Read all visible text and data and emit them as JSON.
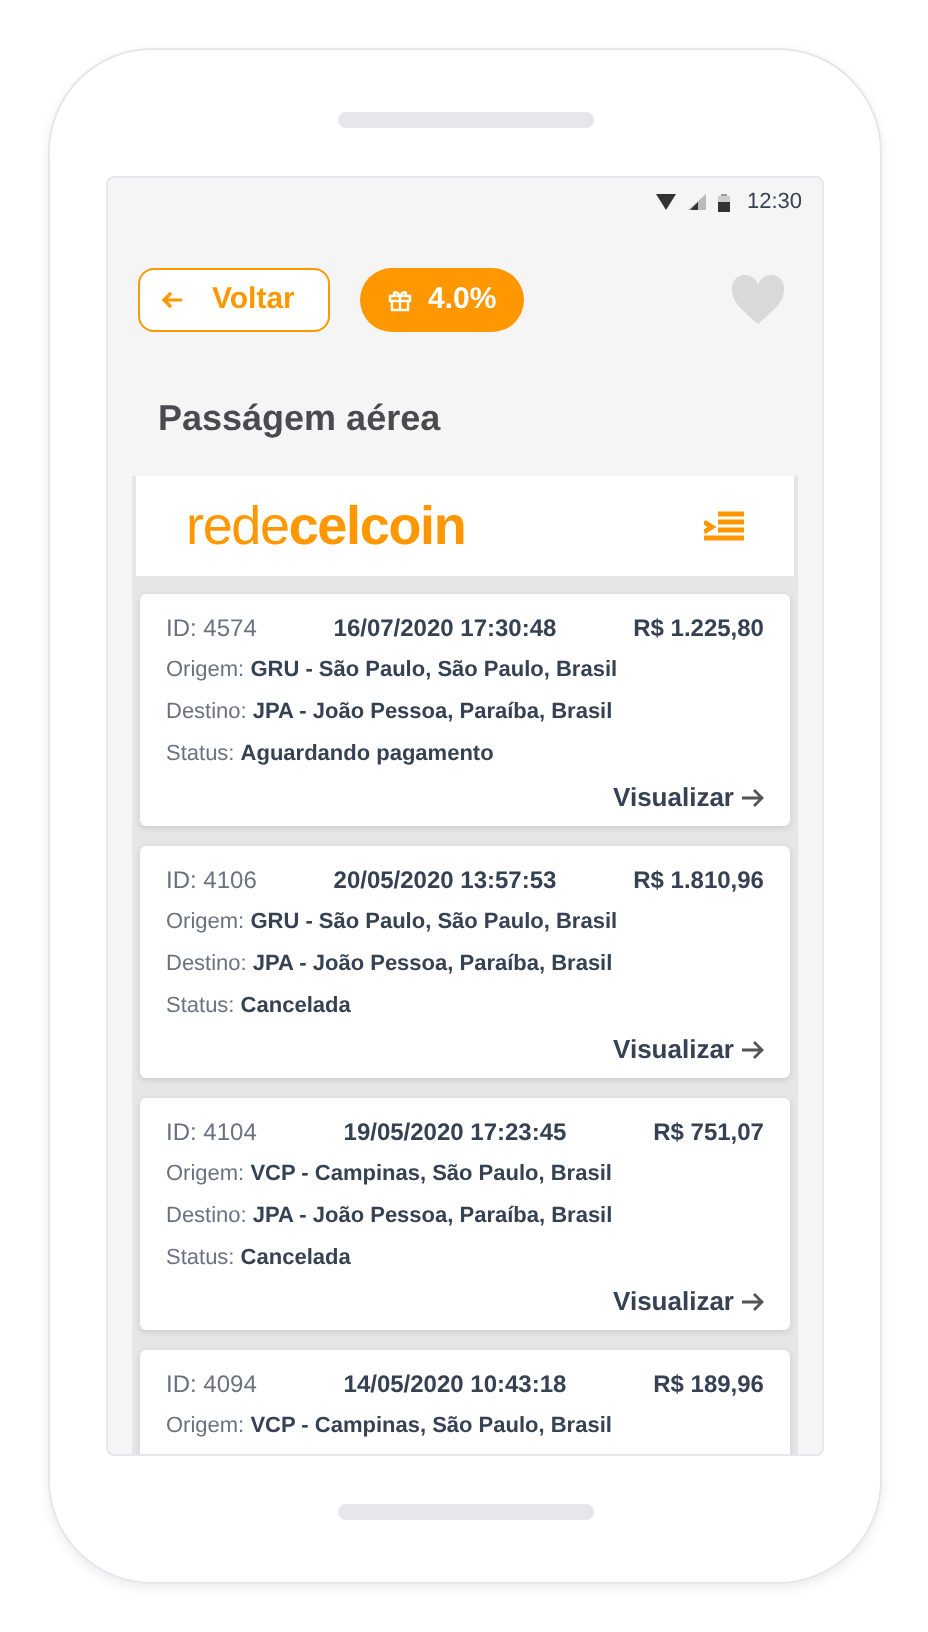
{
  "status_bar": {
    "time": "12:30"
  },
  "toolbar": {
    "back_button": "Voltar",
    "cashback_badge": "4.0%",
    "favorite": false
  },
  "title": "Passágem aérea",
  "logo": {
    "light": "rede",
    "bold": "celcoin"
  },
  "orders": [
    {
      "id": "ID: 4574",
      "date": "16/07/2020 17:30:48",
      "amount": "R$ 1.225,80",
      "details": [
        "Origem: **GRU - São Paulo, São Paulo, Brasil**",
        "Destino: **JPA - João Pessoa, Paraíba, Brasil**",
        "Status: **Aguardando pagamento**"
      ],
      "action": "Visualizar"
    },
    {
      "id": "ID: 4106",
      "date": "20/05/2020 13:57:53",
      "amount": "R$ 1.810,96",
      "details": [
        "Origem: **GRU - São Paulo, São Paulo, Brasil**",
        "Destino: **JPA - João Pessoa, Paraíba, Brasil**",
        "Status: **Cancelada**"
      ],
      "action": "Visualizar"
    },
    {
      "id": "ID: 4104",
      "date": "19/05/2020 17:23:45",
      "amount": "R$ 751,07",
      "details": [
        "Origem: **VCP - Campinas, São Paulo, Brasil**",
        "Destino: **JPA - João Pessoa, Paraíba, Brasil**",
        "Status: **Cancelada**"
      ],
      "action": "Visualizar"
    },
    {
      "id": "ID: 4094",
      "date": "14/05/2020 10:43:18",
      "amount": "R$ 189,96",
      "details": [
        "Origem: **VCP - Campinas, São Paulo, Brasil**"
      ]
    }
  ]
}
